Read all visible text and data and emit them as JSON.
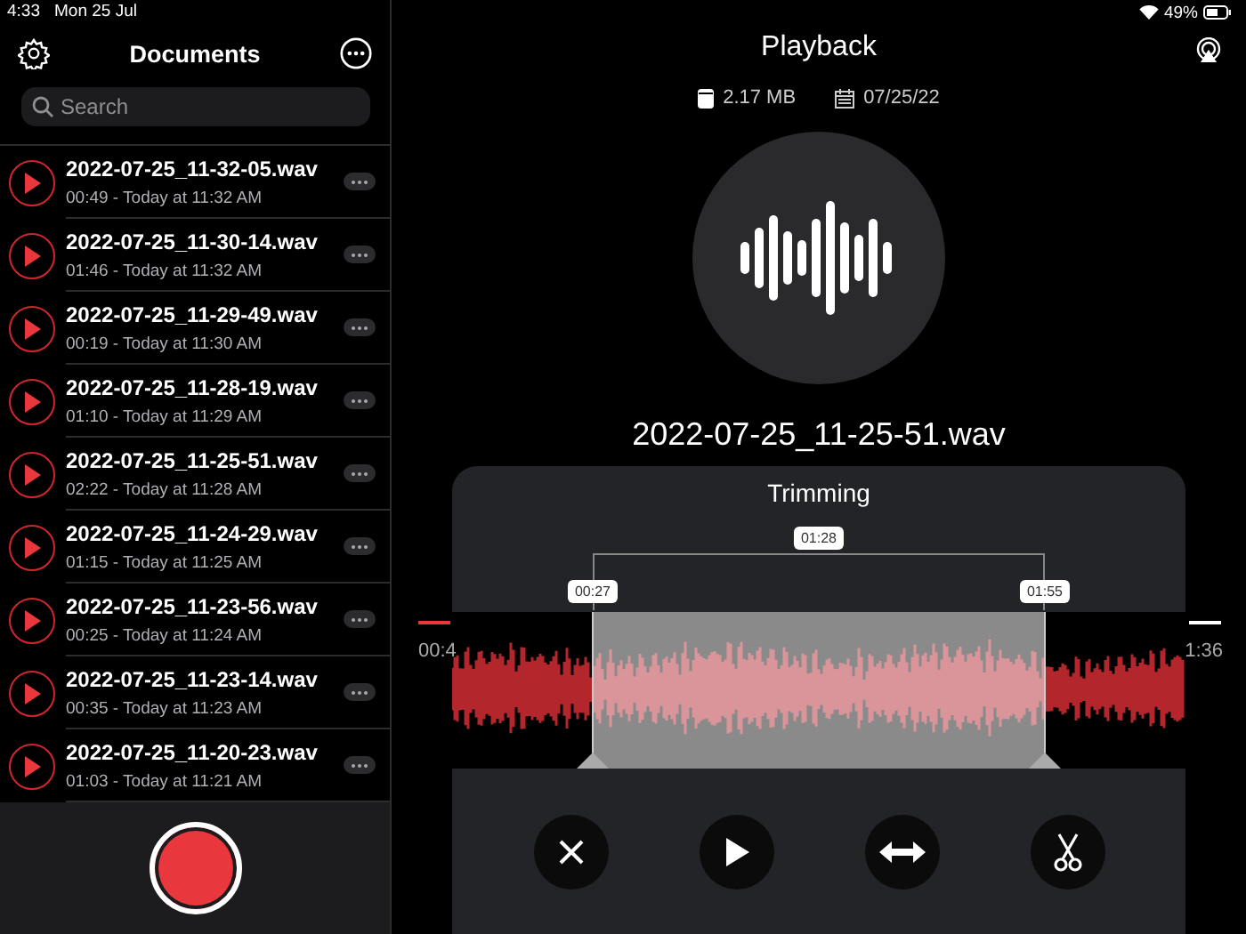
{
  "status_bar": {
    "time": "4:33",
    "date": "Mon 25 Jul",
    "battery": "49%"
  },
  "sidebar": {
    "title": "Documents",
    "search": {
      "placeholder": "Search"
    },
    "recordings": [
      {
        "name": "2022-07-25_11-32-05.wav",
        "details": "00:49 - Today at 11:32 AM"
      },
      {
        "name": "2022-07-25_11-30-14.wav",
        "details": "01:46 - Today at 11:32 AM"
      },
      {
        "name": "2022-07-25_11-29-49.wav",
        "details": "00:19 - Today at 11:30 AM"
      },
      {
        "name": "2022-07-25_11-28-19.wav",
        "details": "01:10 - Today at 11:29 AM"
      },
      {
        "name": "2022-07-25_11-25-51.wav",
        "details": "02:22 - Today at 11:28 AM"
      },
      {
        "name": "2022-07-25_11-24-29.wav",
        "details": "01:15 - Today at 11:25 AM"
      },
      {
        "name": "2022-07-25_11-23-56.wav",
        "details": "00:25 - Today at 11:24 AM"
      },
      {
        "name": "2022-07-25_11-23-14.wav",
        "details": "00:35 - Today at 11:23 AM"
      },
      {
        "name": "2022-07-25_11-20-23.wav",
        "details": "01:03 - Today at 11:21 AM"
      }
    ]
  },
  "playback": {
    "title": "Playback",
    "size": "2.17 MB",
    "date": "07/25/22",
    "file_name": "2022-07-25_11-25-51.wav"
  },
  "trimming": {
    "title": "Trimming",
    "duration": "01:28",
    "start": "00:27",
    "end": "01:55",
    "elapsed": "00:4",
    "remaining": "1:36"
  }
}
